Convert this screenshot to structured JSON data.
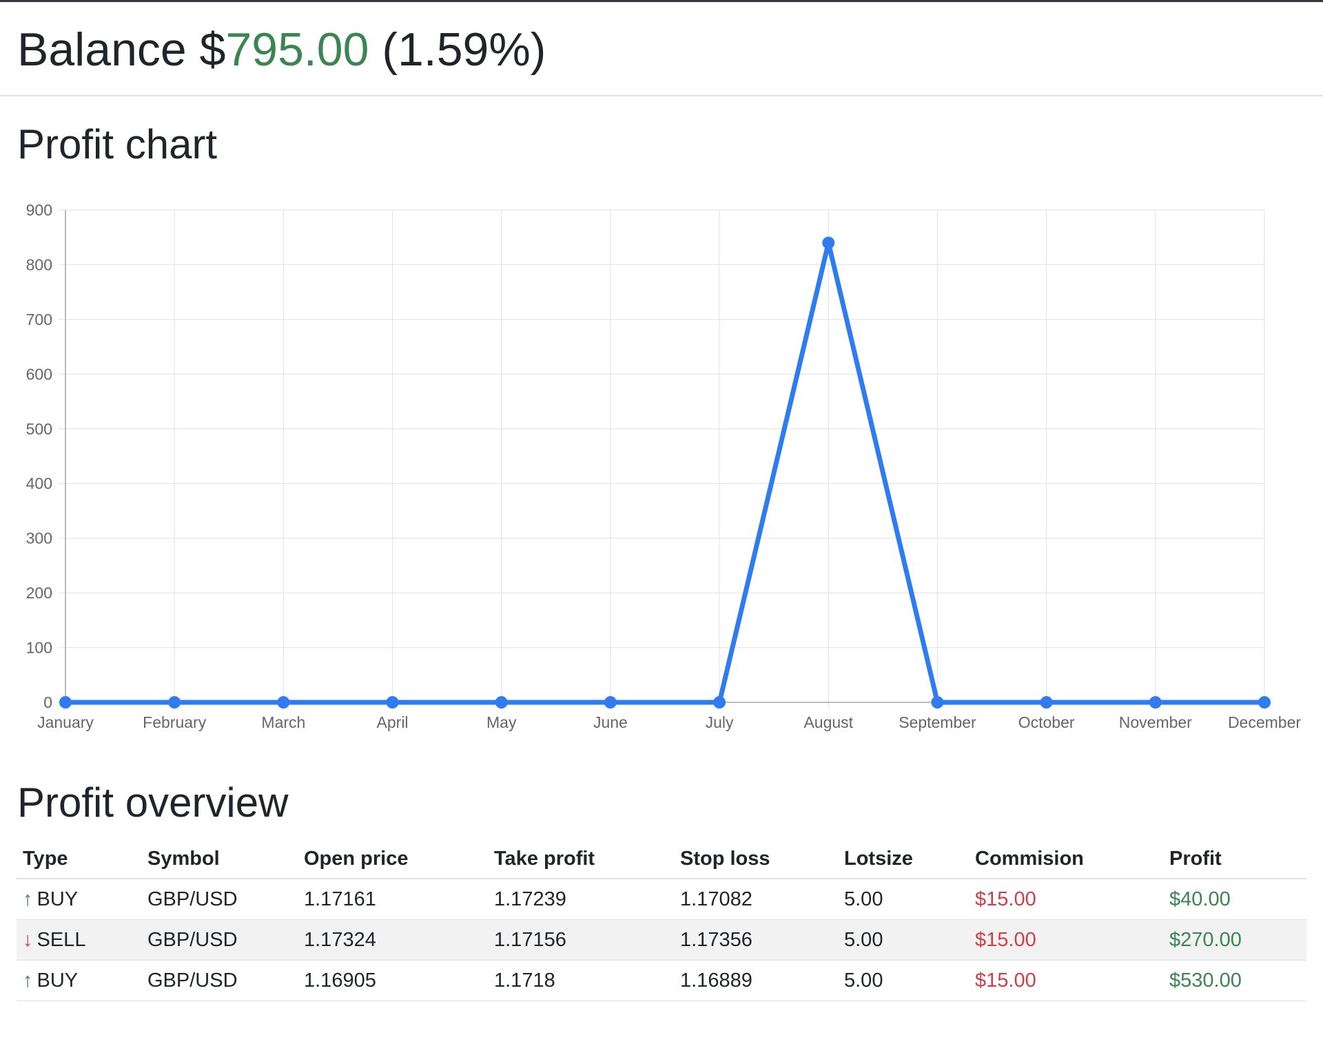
{
  "header": {
    "balance_label": "Balance $",
    "balance_amount": "795.00",
    "balance_percent": "(1.59%)"
  },
  "chart_section": {
    "title": "Profit chart"
  },
  "chart_data": {
    "type": "line",
    "title": "",
    "xlabel": "",
    "ylabel": "",
    "categories": [
      "January",
      "February",
      "March",
      "April",
      "May",
      "June",
      "July",
      "August",
      "September",
      "October",
      "November",
      "December"
    ],
    "series": [
      {
        "values": [
          0,
          0,
          0,
          0,
          0,
          0,
          0,
          840,
          0,
          0,
          0,
          0
        ],
        "color": "#2f7bf0"
      }
    ],
    "ylim": [
      0,
      900
    ],
    "yticks": [
      0,
      100,
      200,
      300,
      400,
      500,
      600,
      700,
      800,
      900
    ],
    "grid": true,
    "legend": "none"
  },
  "overview_section": {
    "title": "Profit overview"
  },
  "table": {
    "columns": [
      "Type",
      "Symbol",
      "Open price",
      "Take profit",
      "Stop loss",
      "Lotsize",
      "Commision",
      "Profit"
    ],
    "rows": [
      {
        "direction": "up",
        "arrow": "↑",
        "type": "BUY",
        "symbol": "GBP/USD",
        "open_price": "1.17161",
        "take_profit": "1.17239",
        "stop_loss": "1.17082",
        "lotsize": "5.00",
        "commission": "$15.00",
        "profit": "$40.00"
      },
      {
        "direction": "down",
        "arrow": "↓",
        "type": "SELL",
        "symbol": "GBP/USD",
        "open_price": "1.17324",
        "take_profit": "1.17156",
        "stop_loss": "1.17356",
        "lotsize": "5.00",
        "commission": "$15.00",
        "profit": "$270.00"
      },
      {
        "direction": "up",
        "arrow": "↑",
        "type": "BUY",
        "symbol": "GBP/USD",
        "open_price": "1.16905",
        "take_profit": "1.1718",
        "stop_loss": "1.16889",
        "lotsize": "5.00",
        "commission": "$15.00",
        "profit": "$530.00"
      }
    ]
  },
  "colors": {
    "positive": "#3b8553",
    "negative": "#d13e47",
    "series_line": "#2f7bf0",
    "grid": "#e5e5e5",
    "axis_text": "#666666"
  }
}
